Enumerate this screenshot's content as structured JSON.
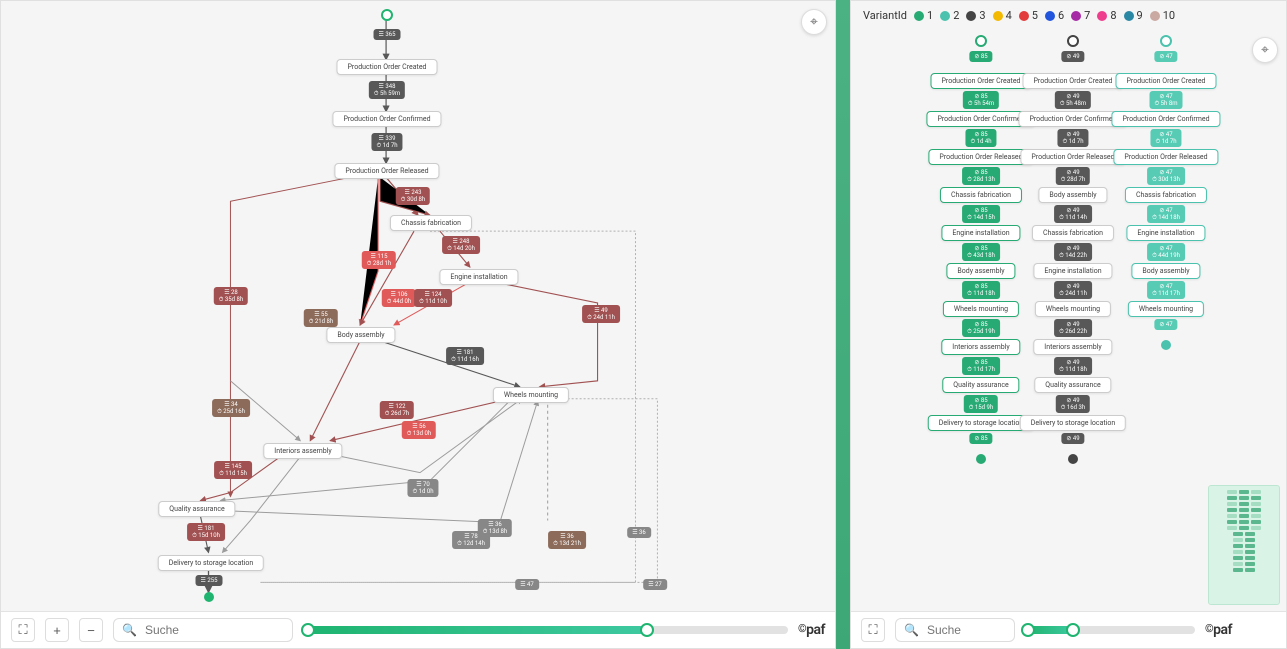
{
  "left": {
    "start_color": "#1fb470",
    "end_color": "#1fb470",
    "nodes": {
      "n1": "Production Order Created",
      "n2": "Production Order Confirmed",
      "n3": "Production Order Released",
      "n4": "Chassis fabrication",
      "n5": "Engine installation",
      "n6": "Body assembly",
      "n7": "Wheels mounting",
      "n8": "Interiors assembly",
      "n9": "Quality assurance",
      "n10": "Delivery to storage location"
    },
    "edge_labels": {
      "e1": [
        "☰ 365"
      ],
      "e2": [
        "☰ 348",
        "⏱ 5h 59m"
      ],
      "e3": [
        "☰ 339",
        "⏱ 1d 7h"
      ],
      "e4": [
        "☰ 243",
        "⏱ 30d 8h"
      ],
      "e5": [
        "☰ 115",
        "⏱ 28d 1h"
      ],
      "e6": [
        "☰ 248",
        "⏱ 14d 20h"
      ],
      "e7a": [
        "☰ 106",
        "⏱ 44d 0h"
      ],
      "e7b": [
        "☰ 124",
        "⏱ 11d 10h"
      ],
      "e8": [
        "☰ 55",
        "⏱ 21d 8h"
      ],
      "e9": [
        "☰ 181",
        "⏱ 11d 16h"
      ],
      "e10": [
        "☰ 49",
        "⏱ 24d 11h"
      ],
      "e11": [
        "☰ 122",
        "⏱ 26d 7h"
      ],
      "e12": [
        "☰ 56",
        "⏱ 13d 0h"
      ],
      "e13": [
        "☰ 145",
        "⏱ 11d 15h"
      ],
      "e14": [
        "☰ 78",
        "⏱ 12d 14h"
      ],
      "e15": [
        "☰ 70",
        "⏱ 1d 0h"
      ],
      "e16": [
        "☰ 181",
        "⏱ 15d 10h"
      ],
      "e17": [
        "☰ 255"
      ],
      "e18": [
        "☰ 28",
        "⏱ 35d 8h"
      ],
      "e19": [
        "☰ 34",
        "⏱ 25d 16h"
      ],
      "e20": [
        "☰ 36",
        "⏱ 13d 21h"
      ],
      "e21": [
        "☰ 36",
        "⏱ 13d 8h"
      ],
      "e22": [
        "☰ 36"
      ],
      "e23": [
        "☰ 47"
      ],
      "e24": [
        "☰ 27"
      ]
    },
    "search_placeholder": "Suche",
    "brand": "paf",
    "slider_left_pct": 1,
    "slider_right_pct": 71
  },
  "right": {
    "legend_title": "VariantId",
    "legend": [
      {
        "num": "1",
        "color": "#28aa74"
      },
      {
        "num": "2",
        "color": "#4bc2ad"
      },
      {
        "num": "3",
        "color": "#444444"
      },
      {
        "num": "4",
        "color": "#f3b900"
      },
      {
        "num": "5",
        "color": "#e33b3b"
      },
      {
        "num": "6",
        "color": "#2255dd"
      },
      {
        "num": "7",
        "color": "#a62aa6"
      },
      {
        "num": "8",
        "color": "#ef3d8e"
      },
      {
        "num": "9",
        "color": "#2b88a5"
      },
      {
        "num": "10",
        "color": "#caa9a2"
      }
    ],
    "lanes": [
      {
        "color": "#28aa74",
        "label_cls": "green",
        "node_cls": "v1",
        "nodes": [
          "Production Order Created",
          "Production Order Confirmed",
          "Production Order Released",
          "Chassis fabrication",
          "Engine installation",
          "Body assembly",
          "Wheels mounting",
          "Interiors assembly",
          "Quality assurance",
          "Delivery to storage location"
        ],
        "edges": [
          [
            "⊘ 85"
          ],
          [
            "⊘ 85",
            "⏱ 5h 54m"
          ],
          [
            "⊘ 85",
            "⏱ 1d 4h"
          ],
          [
            "⊘ 85",
            "⏱ 28d 13h"
          ],
          [
            "⊘ 85",
            "⏱ 14d 15h"
          ],
          [
            "⊘ 85",
            "⏱ 43d 18h"
          ],
          [
            "⊘ 85",
            "⏱ 11d 18h"
          ],
          [
            "⊘ 85",
            "⏱ 25d 19h"
          ],
          [
            "⊘ 85",
            "⏱ 11d 17h"
          ],
          [
            "⊘ 85",
            "⏱ 15d 9h"
          ],
          [
            "⊘ 85"
          ]
        ]
      },
      {
        "color": "#444444",
        "label_cls": "dark",
        "node_cls": "",
        "nodes": [
          "Production Order Created",
          "Production Order Confirmed",
          "Production Order Released",
          "Body assembly",
          "Chassis fabrication",
          "Engine installation",
          "Wheels mounting",
          "Interiors assembly",
          "Quality assurance",
          "Delivery to storage location"
        ],
        "edges": [
          [
            "⊘ 49"
          ],
          [
            "⊘ 49",
            "⏱ 5h 48m"
          ],
          [
            "⊘ 49",
            "⏱ 1d 7h"
          ],
          [
            "⊘ 49",
            "⏱ 28d 7h"
          ],
          [
            "⊘ 49",
            "⏱ 11d 14h"
          ],
          [
            "⊘ 49",
            "⏱ 14d 22h"
          ],
          [
            "⊘ 49",
            "⏱ 24d 11h"
          ],
          [
            "⊘ 49",
            "⏱ 26d 22h"
          ],
          [
            "⊘ 49",
            "⏱ 11d 18h"
          ],
          [
            "⊘ 49",
            "⏱ 16d 3h"
          ],
          [
            "⊘ 49"
          ]
        ]
      },
      {
        "color": "#4bc2ad",
        "label_cls": "teal",
        "node_cls": "v2",
        "nodes": [
          "Production Order Created",
          "Production Order Confirmed",
          "Production Order Released",
          "Chassis fabrication",
          "Engine installation",
          "Body assembly",
          "Wheels mounting"
        ],
        "edges": [
          [
            "⊘ 47"
          ],
          [
            "⊘ 47",
            "⏱ 5h 8m"
          ],
          [
            "⊘ 47",
            "⏱ 1d 7h"
          ],
          [
            "⊘ 47",
            "⏱ 30d 13h"
          ],
          [
            "⊘ 47",
            "⏱ 14d 18h"
          ],
          [
            "⊘ 47",
            "⏱ 44d 19h"
          ],
          [
            "⊘ 47",
            "⏱ 11d 17h"
          ],
          [
            "⊘ 47"
          ]
        ]
      }
    ],
    "search_placeholder": "Suche",
    "brand": "paf",
    "slider_left_pct": 2,
    "slider_right_pct": 28
  }
}
